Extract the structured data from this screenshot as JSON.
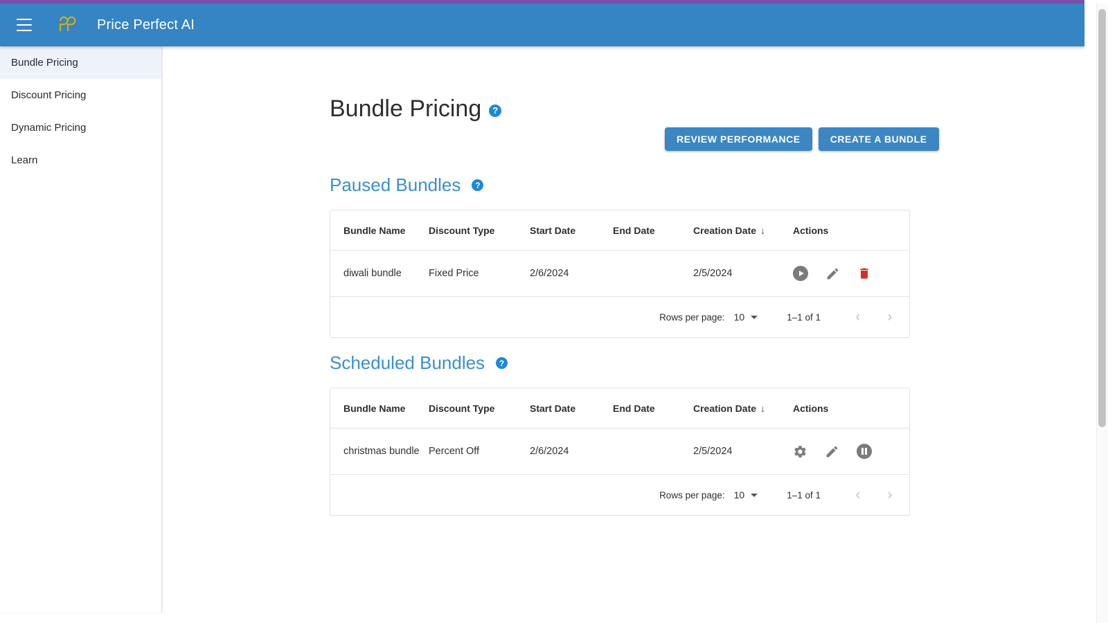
{
  "theme": {
    "primary": "#3585c4",
    "accent_blue": "#3b8ed0",
    "help_blue": "#1e88d8",
    "logo_gold": "#d4b017",
    "delete_red": "#d32f2f",
    "icon_gray": "#7b7b7b",
    "top_strip_purple": "#7b4fa8",
    "active_nav_bg": "#eef3fb"
  },
  "appbar": {
    "menu_icon": "hamburger-menu-icon",
    "logo_icon": "pp-logo-icon",
    "title": "Price Perfect AI"
  },
  "sidebar": {
    "items": [
      {
        "label": "Bundle Pricing",
        "active": true
      },
      {
        "label": "Discount Pricing",
        "active": false
      },
      {
        "label": "Dynamic Pricing",
        "active": false
      },
      {
        "label": "Learn",
        "active": false
      }
    ]
  },
  "page": {
    "title": "Bundle Pricing",
    "help_icon": "help-circle-icon",
    "help_glyph": "?"
  },
  "toolbar": {
    "review_performance_label": "REVIEW PERFORMANCE",
    "create_bundle_label": "CREATE A BUNDLE"
  },
  "sections": [
    {
      "id": "paused",
      "title": "Paused Bundles",
      "help_glyph": "?",
      "columns": [
        "Bundle Name",
        "Discount Type",
        "Start Date",
        "End Date",
        "Creation Date",
        "Actions"
      ],
      "sorted_column": "Creation Date",
      "sort_arrow": "↓",
      "rows": [
        {
          "bundle_name": "diwali bundle",
          "discount_type": "Fixed Price",
          "start_date": "2/6/2024",
          "end_date": "",
          "creation_date": "2/5/2024",
          "actions": [
            "play-circle-icon",
            "edit-pencil-icon",
            "delete-trash-icon"
          ]
        }
      ],
      "pagination": {
        "rows_per_page_label": "Rows per page:",
        "rows_per_page_value": "10",
        "range_label": "1–1 of 1",
        "prev_glyph": "‹",
        "next_glyph": "›"
      }
    },
    {
      "id": "scheduled",
      "title": "Scheduled Bundles",
      "help_glyph": "?",
      "columns": [
        "Bundle Name",
        "Discount Type",
        "Start Date",
        "End Date",
        "Creation Date",
        "Actions"
      ],
      "sorted_column": "Creation Date",
      "sort_arrow": "↓",
      "rows": [
        {
          "bundle_name": "christmas bundle",
          "discount_type": "Percent Off",
          "start_date": "2/6/2024",
          "end_date": "",
          "creation_date": "2/5/2024",
          "actions": [
            "settings-gear-icon",
            "edit-pencil-icon",
            "pause-circle-icon"
          ]
        }
      ],
      "pagination": {
        "rows_per_page_label": "Rows per page:",
        "rows_per_page_value": "10",
        "range_label": "1–1 of 1",
        "prev_glyph": "‹",
        "next_glyph": "›"
      }
    }
  ]
}
